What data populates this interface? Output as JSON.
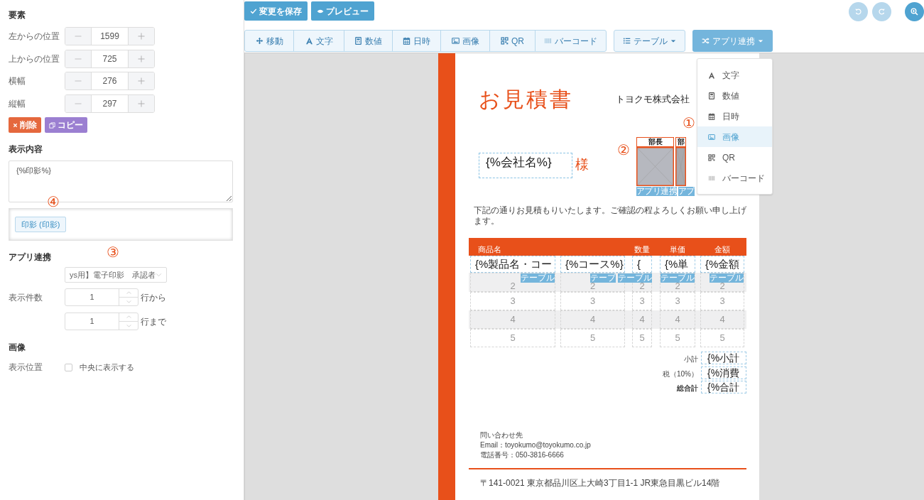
{
  "properties": {
    "title": "要素",
    "fields": [
      {
        "label": "左からの位置",
        "value": "1599"
      },
      {
        "label": "上からの位置",
        "value": "725"
      },
      {
        "label": "横幅",
        "value": "276"
      },
      {
        "label": "縦幅",
        "value": "297"
      }
    ]
  },
  "actions": [
    {
      "kind": "delete",
      "label": "削除"
    },
    {
      "kind": "copy",
      "label": "コピー"
    }
  ],
  "content": {
    "title": "表示内容",
    "value": "{%印影%}",
    "annotation": "④",
    "tags": [
      "印影 (印影)"
    ]
  },
  "app_link": {
    "title": "アプリ連携",
    "annotation": "③",
    "select": "ys用】電子印影　承認者",
    "count_label": "表示件数",
    "ranges": [
      {
        "value": "1",
        "suffix": "行から"
      },
      {
        "value": "1",
        "suffix": "行まで"
      }
    ]
  },
  "image": {
    "title": "画像",
    "position_label": "表示位置",
    "center": {
      "label": "中央に表示する",
      "checked": false
    }
  },
  "top_buttons": [
    {
      "kind": "save",
      "label": "変更を保存"
    },
    {
      "kind": "preview",
      "label": "プレビュー"
    }
  ],
  "tools": [
    {
      "kind": "move",
      "label": "移動"
    },
    {
      "kind": "text",
      "label": "文字"
    },
    {
      "kind": "number",
      "label": "数値"
    },
    {
      "kind": "date",
      "label": "日時"
    },
    {
      "kind": "image",
      "label": "画像"
    },
    {
      "kind": "qr",
      "label": "QR"
    },
    {
      "kind": "barcode",
      "label": "バーコード"
    }
  ],
  "table_menu": {
    "label": "テーブル"
  },
  "app_menu": {
    "label": "アプリ連携",
    "expanded": true
  },
  "history": {
    "undo_disabled": true,
    "redo_disabled": true
  },
  "dropdown": {
    "annotation": "①",
    "items": [
      {
        "kind": "text",
        "label": "文字",
        "selected": false
      },
      {
        "kind": "number",
        "label": "数値",
        "selected": false
      },
      {
        "kind": "date",
        "label": "日時",
        "selected": false
      },
      {
        "kind": "image",
        "label": "画像",
        "selected": true
      },
      {
        "kind": "qr",
        "label": "QR",
        "selected": false
      },
      {
        "kind": "barcode",
        "label": "バーコード",
        "selected": false
      }
    ]
  },
  "document": {
    "title": "お見積書",
    "company": "トヨクモ株式会社",
    "customer": "{%会社名%}",
    "honorific": "様",
    "annotation": "②",
    "stamps": [
      {
        "header": "部長",
        "tag": "アプリ連携"
      },
      {
        "header": "部",
        "tag": "アプ"
      }
    ],
    "message": "下記の通りお見積もりいたします。ご確認の程よろしくお願い申し上げます。",
    "columns": [
      {
        "header": "商品名",
        "placeholder": "{%製品名・コー",
        "tag": "テーブル",
        "rows": [
          "2",
          "3",
          "4",
          "5"
        ]
      },
      {
        "placeholder": "{%コース%}",
        "tag": "テーブ",
        "rows": [
          "2",
          "3",
          "4",
          "5"
        ]
      },
      {
        "header": "数量",
        "placeholder": "{",
        "tag": "テーブル",
        "rows": [
          "2",
          "3",
          "4",
          "5"
        ]
      },
      {
        "header": "単価",
        "placeholder": "{%単",
        "tag": "テーブル",
        "rows": [
          "2",
          "3",
          "4",
          "5"
        ]
      },
      {
        "header": "金額",
        "placeholder": "{%金額",
        "tag": "テーブル",
        "rows": [
          "2",
          "3",
          "4",
          "5"
        ]
      }
    ],
    "totals": [
      {
        "label": "小計",
        "value": "{%小計",
        "bold": false
      },
      {
        "label": "税（10%）",
        "value": "{%消費",
        "bold": false
      },
      {
        "label": "総合計",
        "value": "{%合計",
        "bold": true
      }
    ],
    "contact": [
      "問い合わせ先",
      "Email：toyokumo@toyokumo.co.jp",
      "電話番号：050-3816-6666"
    ],
    "address": "〒141-0021 東京都品川区上大崎3丁目1-1 JR東急目黒ビル14階"
  }
}
